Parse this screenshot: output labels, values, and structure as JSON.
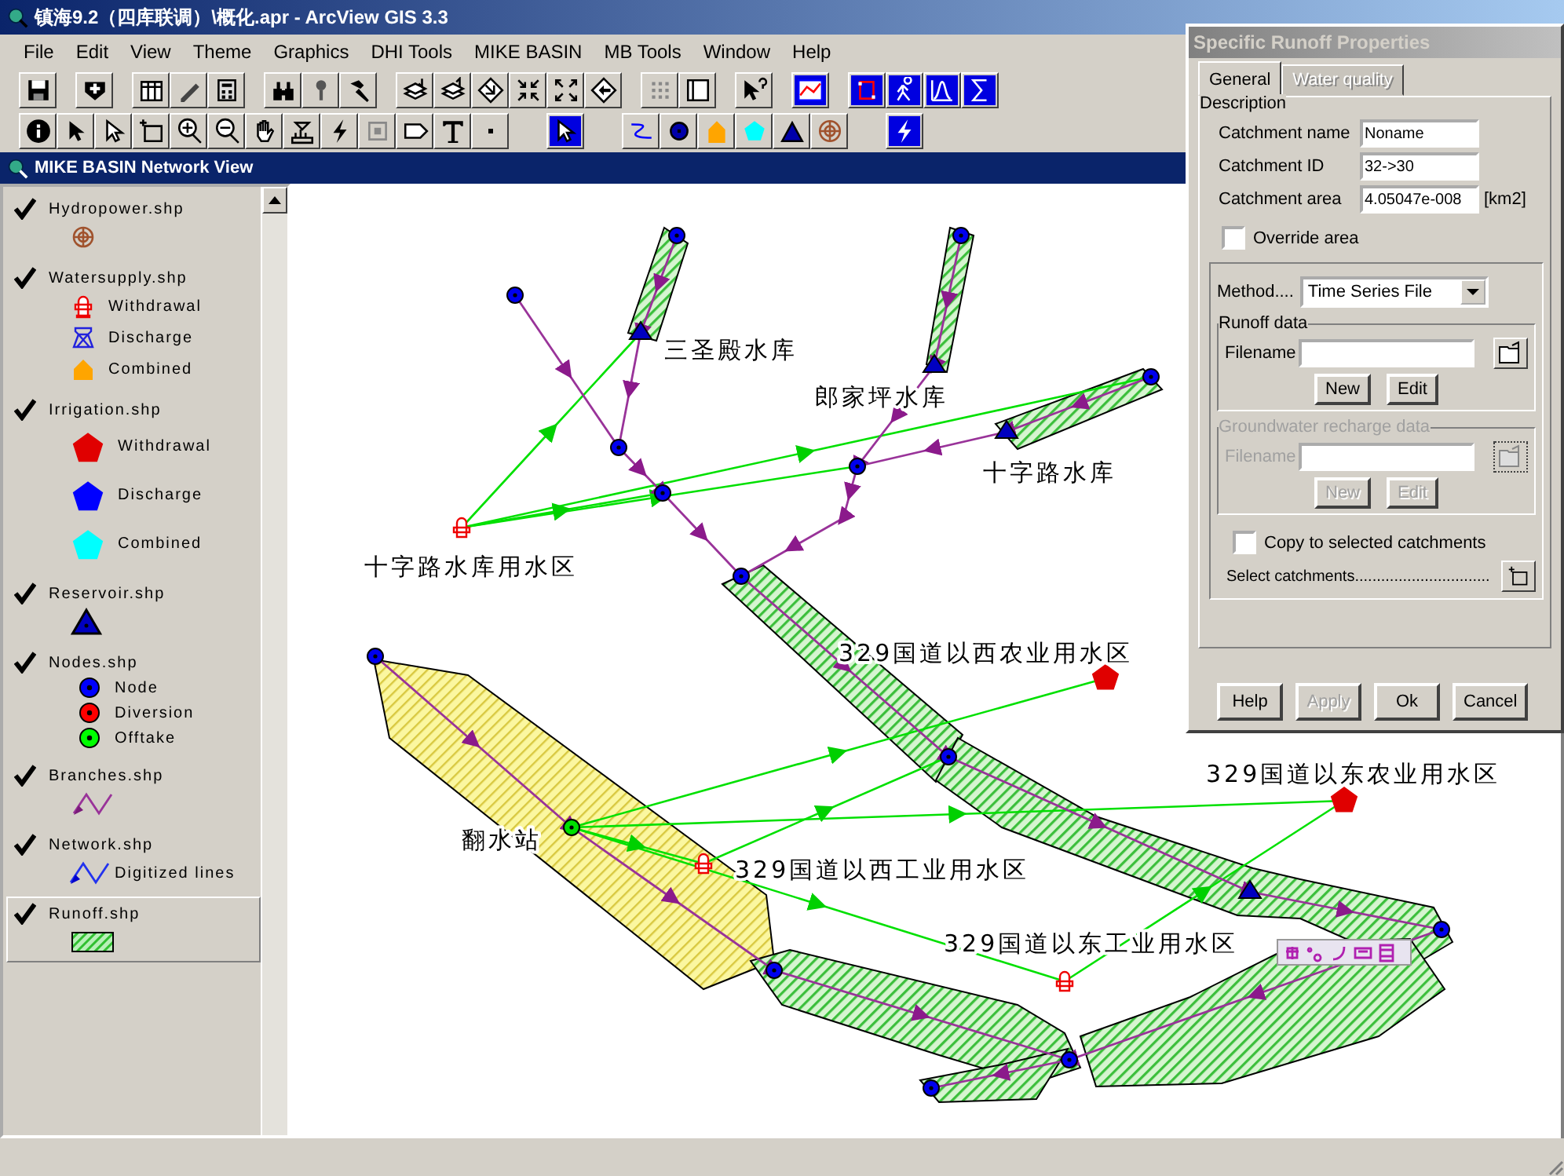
{
  "window": {
    "title": "镇海9.2（四库联调）\\概化.apr - ArcView GIS 3.3"
  },
  "menu": [
    {
      "label": "File"
    },
    {
      "label": "Edit"
    },
    {
      "label": "View"
    },
    {
      "label": "Theme"
    },
    {
      "label": "Graphics"
    },
    {
      "label": "DHI Tools"
    },
    {
      "label": "MIKE BASIN"
    },
    {
      "label": "MB Tools"
    },
    {
      "label": "Window"
    },
    {
      "label": "Help"
    }
  ],
  "view": {
    "title": "MIKE BASIN Network View"
  },
  "legend": [
    {
      "name": "Hydropower.shp",
      "visible": true,
      "selected": false,
      "items": [
        {
          "kind": "wheel"
        }
      ]
    },
    {
      "name": "Watersupply.shp",
      "visible": true,
      "selected": false,
      "items": [
        {
          "kind": "hydrant",
          "label": "Withdrawal"
        },
        {
          "kind": "tower",
          "label": "Discharge"
        },
        {
          "kind": "house",
          "label": "Combined"
        }
      ]
    },
    {
      "name": "Irrigation.shp",
      "visible": true,
      "selected": false,
      "items": [
        {
          "kind": "pentagon",
          "color": "#e00000",
          "label": "Withdrawal"
        },
        {
          "kind": "pentagon",
          "color": "#0000ff",
          "label": "Discharge"
        },
        {
          "kind": "pentagon",
          "color": "#00ffff",
          "label": "Combined"
        }
      ]
    },
    {
      "name": "Reservoir.shp",
      "visible": true,
      "selected": false,
      "items": [
        {
          "kind": "triangle"
        }
      ]
    },
    {
      "name": "Nodes.shp",
      "visible": true,
      "selected": false,
      "items": [
        {
          "kind": "node",
          "color": "#0000ff",
          "label": "Node"
        },
        {
          "kind": "node",
          "color": "#ff0000",
          "label": "Diversion"
        },
        {
          "kind": "node",
          "color": "#00ff00",
          "label": "Offtake"
        }
      ]
    },
    {
      "name": "Branches.shp",
      "visible": true,
      "selected": false,
      "items": [
        {
          "kind": "branch-line"
        }
      ]
    },
    {
      "name": "Network.shp",
      "visible": true,
      "selected": false,
      "items": [
        {
          "kind": "network-line",
          "label": "Digitized lines"
        }
      ]
    },
    {
      "name": "Runoff.shp",
      "visible": true,
      "selected": true,
      "items": [
        {
          "kind": "hatch"
        }
      ]
    }
  ],
  "map": {
    "labels": [
      "三圣殿水库",
      "郎家坪水库",
      "十字路水库",
      "十字路水库用水区",
      "329国道以西农业用水区",
      "329国道以东农业用水区",
      "翻水站",
      "329国道以西工业用水区",
      "329国道以东工业用水区"
    ]
  },
  "dialog": {
    "title": "Specific Runoff Properties",
    "tabs": [
      {
        "label": "General",
        "selected": true,
        "disabled": false
      },
      {
        "label": "Water quality",
        "selected": false,
        "disabled": true
      }
    ],
    "description": "Description",
    "fields": [
      {
        "label": "Catchment name",
        "value": "Noname"
      },
      {
        "label": "Catchment ID",
        "value": "32->30"
      },
      {
        "label": "Catchment area",
        "value": "4.05047e-008",
        "unit": "[km2]"
      }
    ],
    "override": {
      "label": "Override area",
      "checked": false
    },
    "method": {
      "label": "Method....",
      "value": "Time Series File"
    },
    "groups": [
      {
        "title": "Runoff data",
        "filename_label": "Filename",
        "disabled": false,
        "buttons": [
          "New",
          "Edit"
        ]
      },
      {
        "title": "Groundwater recharge data",
        "filename_label": "Filename",
        "disabled": true,
        "buttons": [
          "New",
          "Edit"
        ]
      }
    ],
    "copy": {
      "label": "Copy to selected catchments",
      "checked": false
    },
    "select_label": "Select catchments...............................",
    "buttons": [
      {
        "label": "Help",
        "disabled": false
      },
      {
        "label": "Apply",
        "disabled": true
      },
      {
        "label": "Ok",
        "disabled": false
      },
      {
        "label": "Cancel",
        "disabled": false
      }
    ]
  }
}
